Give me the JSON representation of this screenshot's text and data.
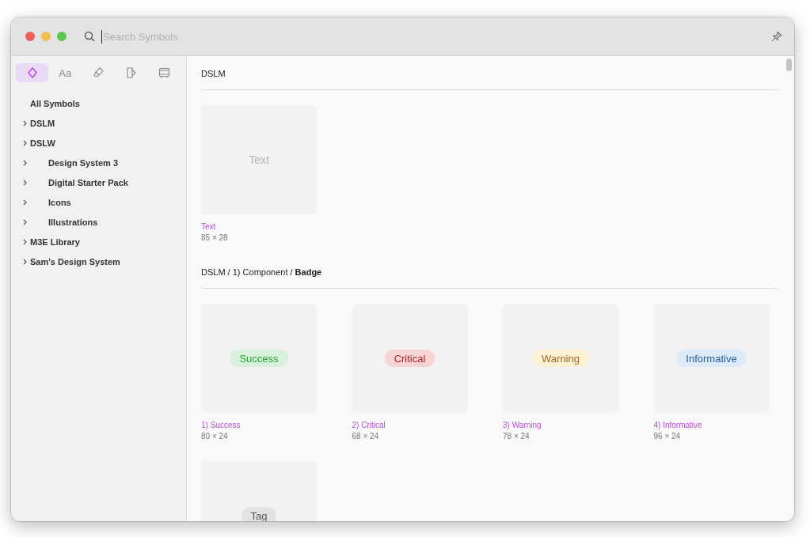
{
  "window": {
    "search": {
      "placeholder": "Search Symbols"
    }
  },
  "sidebar": {
    "tabs": [
      {
        "kind": "symbol",
        "selected": true
      },
      {
        "kind": "text",
        "label": "Aa",
        "selected": false
      },
      {
        "kind": "style",
        "selected": false
      },
      {
        "kind": "layer",
        "selected": false
      },
      {
        "kind": "frame",
        "selected": false
      }
    ],
    "items": [
      {
        "kind": "all",
        "label": "All Symbols"
      },
      {
        "kind": "group",
        "label": "DSLM"
      },
      {
        "kind": "group",
        "label": "DSLW",
        "children": [
          {
            "kind": "group",
            "label": "Design System 3"
          },
          {
            "kind": "group",
            "label": "Digital Starter Pack"
          },
          {
            "kind": "group",
            "label": "Icons"
          },
          {
            "kind": "group",
            "label": "Illustrations"
          }
        ]
      },
      {
        "kind": "group",
        "label": "M3E Library"
      },
      {
        "kind": "group",
        "label": "Sam's Design System"
      }
    ]
  },
  "sections": [
    {
      "title": "DSLM",
      "symbols": [
        {
          "kind": "text",
          "preview": "Text",
          "name": "Text",
          "size": "85 × 28"
        }
      ]
    },
    {
      "title": "DSLM / 1) Component / **Badge**",
      "symbols": [
        {
          "kind": "badge",
          "preview": "Success",
          "color": "#d9f0dc",
          "name": "1) Success",
          "size": "80 × 24"
        },
        {
          "kind": "badge",
          "preview": "Critical",
          "color": "#f6d3d4",
          "name": "2) Critical",
          "size": "68 × 24"
        },
        {
          "kind": "badge",
          "preview": "Warning",
          "color": "#fdf1d3",
          "name": "3) Warning",
          "size": "78 × 24"
        },
        {
          "kind": "badge",
          "preview": "Informative",
          "color": "#dcebf7",
          "name": "4) Informative",
          "size": "96 × 24"
        },
        {
          "kind": "badge",
          "preview": "Tag",
          "color": "#e3e3e3"
        }
      ]
    }
  ]
}
